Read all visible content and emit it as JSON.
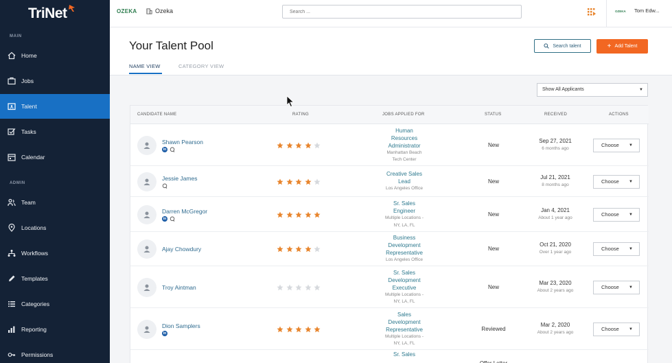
{
  "sidebar": {
    "logo": "TriNet",
    "sections": {
      "main": "MAIN",
      "admin": "ADMIN"
    },
    "items": [
      {
        "label": "Home",
        "icon": "home-icon",
        "active": false
      },
      {
        "label": "Jobs",
        "icon": "briefcase-icon",
        "active": false
      },
      {
        "label": "Talent",
        "icon": "talent-card-icon",
        "active": true
      },
      {
        "label": "Tasks",
        "icon": "tasks-icon",
        "active": false
      },
      {
        "label": "Calendar",
        "icon": "calendar-icon",
        "active": false
      },
      {
        "label": "Team",
        "icon": "team-icon",
        "active": false
      },
      {
        "label": "Locations",
        "icon": "location-pin-icon",
        "active": false
      },
      {
        "label": "Workflows",
        "icon": "workflow-icon",
        "active": false
      },
      {
        "label": "Templates",
        "icon": "pencil-icon",
        "active": false
      },
      {
        "label": "Categories",
        "icon": "list-icon",
        "active": false
      },
      {
        "label": "Reporting",
        "icon": "bar-chart-icon",
        "active": false
      },
      {
        "label": "Permissions",
        "icon": "key-icon",
        "active": false
      }
    ],
    "accent": "#1870c4",
    "background": "#142236"
  },
  "topbar": {
    "company_logo": "OZEKA",
    "company_name": "Ozeka",
    "search_placeholder": "Search ...",
    "user_logo": "OZEKA",
    "user_name": "Tom Edw..."
  },
  "header": {
    "title": "Your Talent Pool",
    "tabs": [
      {
        "label": "NAME VIEW",
        "active": true
      },
      {
        "label": "CATEGORY VIEW",
        "active": false
      }
    ],
    "search_talent_label": "Search talent",
    "add_talent_label": "Add Talent",
    "add_talent_color": "#f26722"
  },
  "filter": {
    "selected": "Show All Applicants"
  },
  "table": {
    "columns": [
      "CANDIDATE NAME",
      "RATING",
      "JOBS APPLIED FOR",
      "STATUS",
      "RECEIVED",
      "ACTIONS"
    ],
    "rows": [
      {
        "name": "Shawn Pearson",
        "linkedin": true,
        "chat": true,
        "rating": 4,
        "job_title": [
          "Human",
          "Resources",
          "Administrator"
        ],
        "job_loc": [
          "Manhattan Beach",
          "Tech Center"
        ],
        "status": "New",
        "date": "Sep 27, 2021",
        "ago": "6 months ago",
        "action": "Choose"
      },
      {
        "name": "Jessie James",
        "linkedin": false,
        "chat": true,
        "rating": 4,
        "job_title": [
          "Creative Sales",
          "Lead"
        ],
        "job_loc": [
          "Los Angeles Office"
        ],
        "status": "New",
        "date": "Jul 21, 2021",
        "ago": "8 months ago",
        "action": "Choose"
      },
      {
        "name": "Darren McGregor",
        "linkedin": true,
        "chat": true,
        "rating": 5,
        "job_title": [
          "Sr. Sales",
          "Engineer"
        ],
        "job_loc": [
          "Multiple Locations -",
          "NY, LA, FL"
        ],
        "status": "New",
        "date": "Jan 4, 2021",
        "ago": "About 1 year ago",
        "action": "Choose"
      },
      {
        "name": "Ajay Chowdury",
        "linkedin": false,
        "chat": false,
        "rating": 4,
        "job_title": [
          "Business",
          "Development",
          "Representative"
        ],
        "job_loc": [
          "Los Angeles Office"
        ],
        "status": "New",
        "date": "Oct 21, 2020",
        "ago": "Over 1 year ago",
        "action": "Choose"
      },
      {
        "name": "Troy Aintman",
        "linkedin": false,
        "chat": false,
        "rating": 0,
        "job_title": [
          "Sr. Sales",
          "Development",
          "Executive"
        ],
        "job_loc": [
          "Multiple Locations -",
          "NY, LA, FL"
        ],
        "status": "New",
        "date": "Mar 23, 2020",
        "ago": "About 2 years ago",
        "action": "Choose"
      },
      {
        "name": "Dion Samplers",
        "linkedin": true,
        "chat": false,
        "rating": 5,
        "job_title": [
          "Sales",
          "Development",
          "Representative"
        ],
        "job_loc": [
          "Multiple Locations -",
          "NY, LA, FL"
        ],
        "status": "Reviewed",
        "date": "Mar 2, 2020",
        "ago": "About 2 years ago",
        "action": "Choose"
      },
      {
        "name": "",
        "linkedin": false,
        "chat": false,
        "rating": 0,
        "job_title": [
          "Sr. Sales"
        ],
        "job_loc": [],
        "status": "Offer Letter",
        "date": "",
        "ago": "",
        "action": ""
      }
    ],
    "star_filled_color": "#e8852d",
    "star_empty_color": "#d6d9dd"
  }
}
